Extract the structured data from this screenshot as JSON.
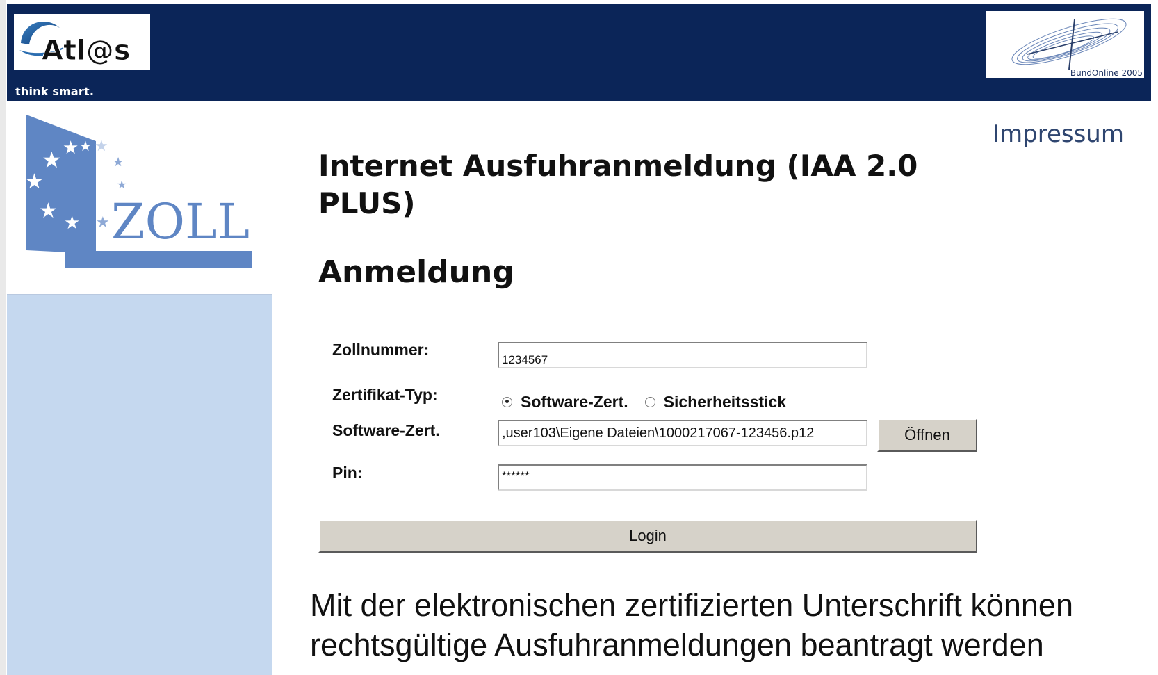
{
  "header": {
    "brand_text": "Atl@s",
    "tagline": "think smart.",
    "partner_logo_text": "BundOnline 2005"
  },
  "sidebar": {
    "logo_text": "ZOLL"
  },
  "main": {
    "impressum_link": "Impressum",
    "title": "Internet Ausfuhranmeldung (IAA 2.0 PLUS)",
    "section_title": "Anmeldung",
    "form": {
      "zollnummer_label": "Zollnummer:",
      "zollnummer_value": "1234567",
      "cert_type_label": "Zertifikat-Typ:",
      "cert_options": [
        "Software-Zert.",
        "Sicherheitsstick"
      ],
      "cert_selected": "Software-Zert.",
      "software_cert_label": "Software-Zert.",
      "software_cert_value": ",user103\\Eigene Dateien\\1000217067-123456.p12",
      "open_button": "Öffnen",
      "pin_label": "Pin:",
      "pin_value": "******",
      "login_button": "Login"
    },
    "info_text": "Mit der elektronischen zertifizierten Unterschrift können rechtsgültige Ausfuhranmeldungen beantragt werden"
  },
  "colors": {
    "banner": "#0b2558",
    "sidebar": "#c5d8ef",
    "zoll_blue": "#5f86c4",
    "link": "#2f4670",
    "button_face": "#d6d2c9"
  }
}
